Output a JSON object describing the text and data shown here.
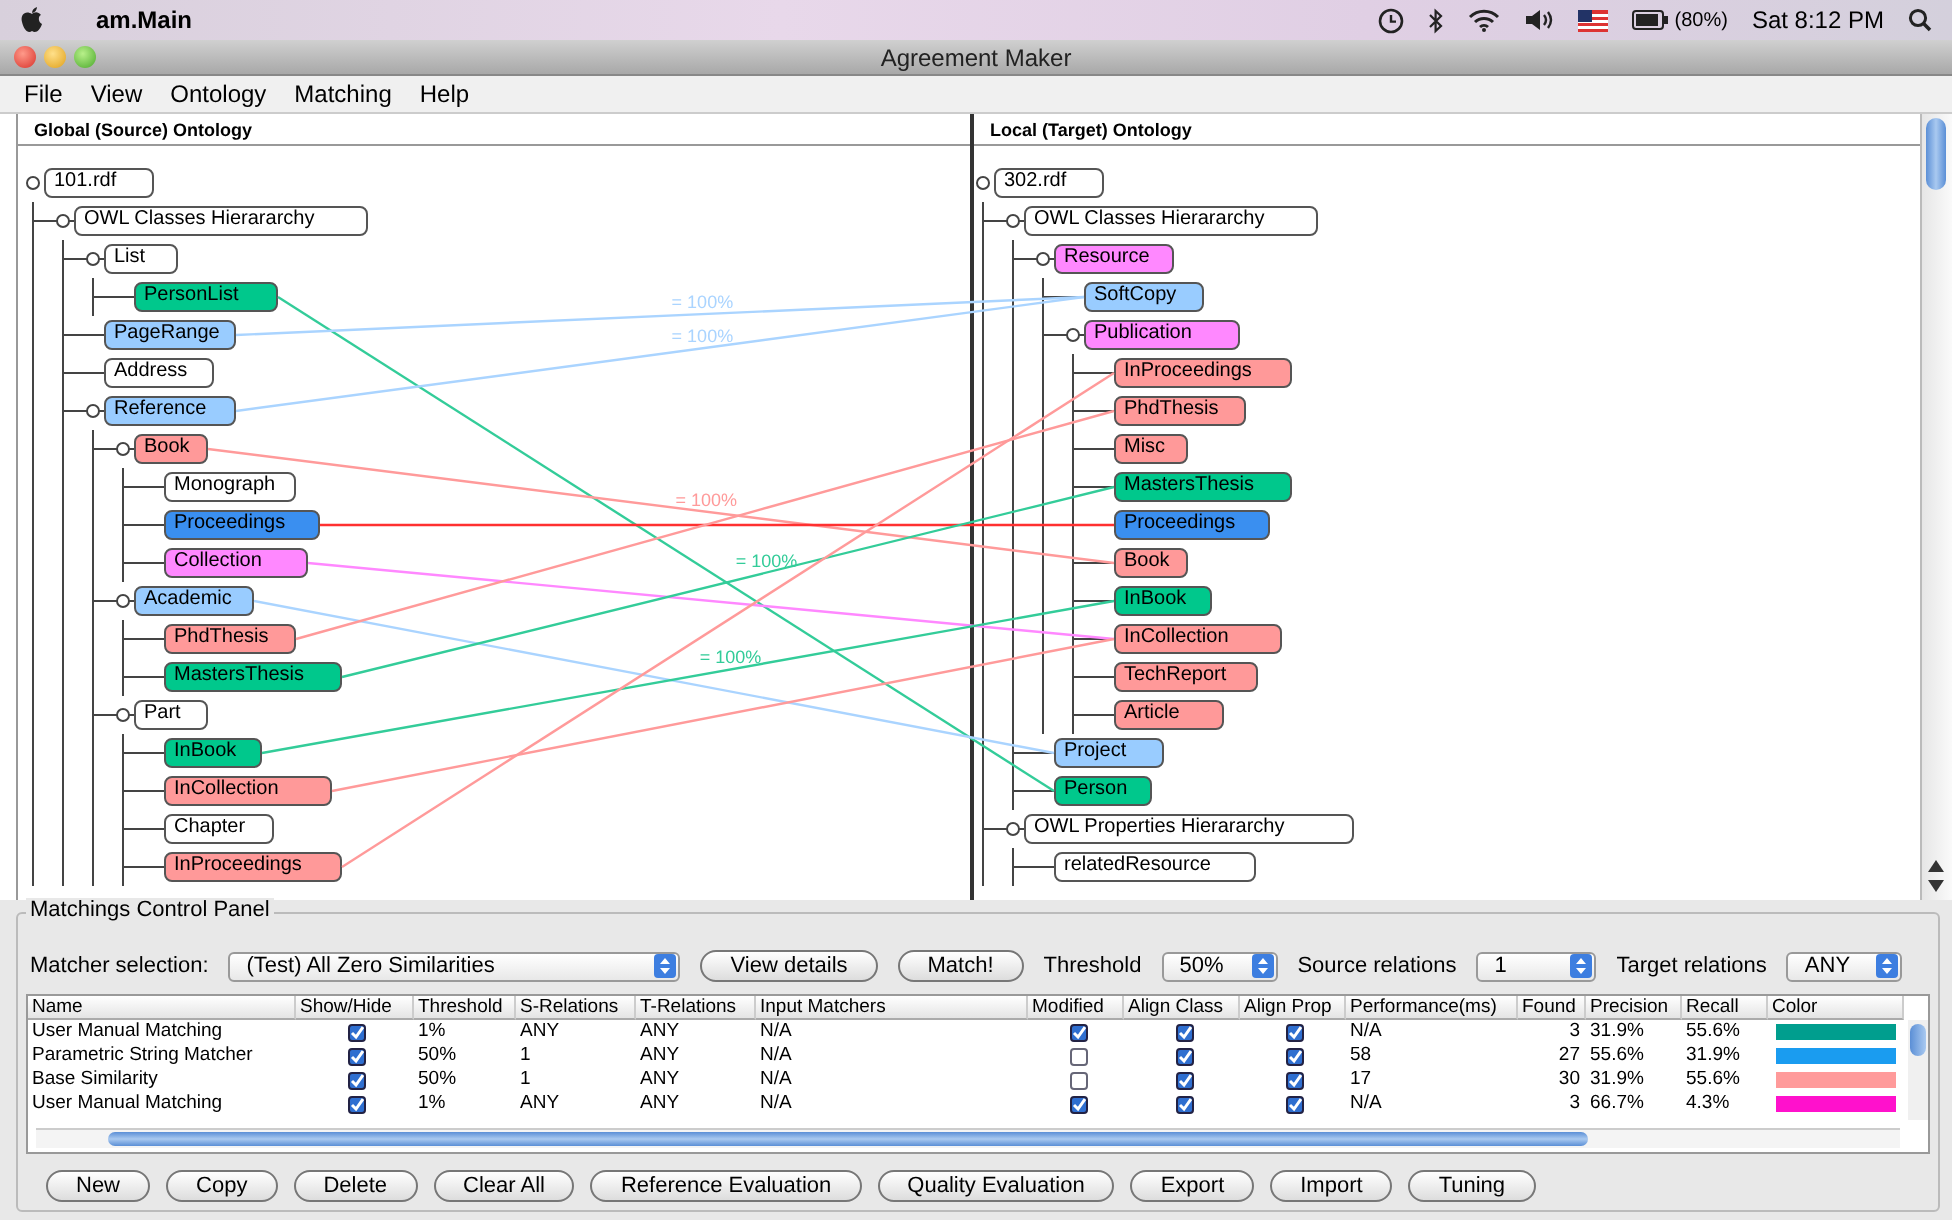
{
  "menubar": {
    "app": "am.Main",
    "battery": "(80%)",
    "clock": "Sat 8:12 PM"
  },
  "window": {
    "title": "Agreement Maker"
  },
  "menu": [
    "File",
    "View",
    "Ontology",
    "Matching",
    "Help"
  ],
  "source_panel": {
    "title": "Global (Source) Ontology",
    "tree": [
      {
        "label": "101.rdf",
        "color": "#ffffff",
        "children": [
          {
            "label": "OWL Classes Hierararchy",
            "color": "#ffffff",
            "children": [
              {
                "label": "List",
                "color": "#ffffff",
                "children": [
                  {
                    "label": "PersonList",
                    "color": "#00c88c"
                  }
                ]
              },
              {
                "label": "PageRange",
                "color": "#99ccff"
              },
              {
                "label": "Address",
                "color": "#ffffff"
              },
              {
                "label": "Reference",
                "color": "#99ccff",
                "children": [
                  {
                    "label": "Book",
                    "color": "#ff9999",
                    "children": [
                      {
                        "label": "Monograph",
                        "color": "#ffffff"
                      },
                      {
                        "label": "Proceedings",
                        "color": "#3a8ff0"
                      },
                      {
                        "label": "Collection",
                        "color": "#ff88ff"
                      }
                    ]
                  },
                  {
                    "label": "Academic",
                    "color": "#99ccff",
                    "children": [
                      {
                        "label": "PhdThesis",
                        "color": "#ff9999"
                      },
                      {
                        "label": "MastersThesis",
                        "color": "#00c88c"
                      }
                    ]
                  },
                  {
                    "label": "Part",
                    "color": "#ffffff",
                    "children": [
                      {
                        "label": "InBook",
                        "color": "#00c88c"
                      },
                      {
                        "label": "InCollection",
                        "color": "#ff9999"
                      },
                      {
                        "label": "Chapter",
                        "color": "#ffffff"
                      },
                      {
                        "label": "InProceedings",
                        "color": "#ff9999"
                      }
                    ]
                  }
                ]
              }
            ]
          }
        ]
      }
    ]
  },
  "target_panel": {
    "title": "Local (Target) Ontology",
    "tree": [
      {
        "label": "302.rdf",
        "color": "#ffffff",
        "children": [
          {
            "label": "OWL Classes Hierararchy",
            "color": "#ffffff",
            "children": [
              {
                "label": "Resource",
                "color": "#ff88ff",
                "children": [
                  {
                    "label": "SoftCopy",
                    "color": "#99ccff"
                  },
                  {
                    "label": "Publication",
                    "color": "#ff88ff",
                    "children": [
                      {
                        "label": "InProceedings",
                        "color": "#ff9999"
                      },
                      {
                        "label": "PhdThesis",
                        "color": "#ff9999"
                      },
                      {
                        "label": "Misc",
                        "color": "#ff9999"
                      },
                      {
                        "label": "MastersThesis",
                        "color": "#00c88c"
                      },
                      {
                        "label": "Proceedings",
                        "color": "#3a8ff0"
                      },
                      {
                        "label": "Book",
                        "color": "#ff9999"
                      },
                      {
                        "label": "InBook",
                        "color": "#00c88c"
                      },
                      {
                        "label": "InCollection",
                        "color": "#ff9999"
                      },
                      {
                        "label": "TechReport",
                        "color": "#ff9999"
                      },
                      {
                        "label": "Article",
                        "color": "#ff9999"
                      }
                    ]
                  }
                ]
              },
              {
                "label": "Project",
                "color": "#99ccff"
              },
              {
                "label": "Person",
                "color": "#00c88c"
              }
            ]
          },
          {
            "label": "OWL Properties Hierararchy",
            "color": "#ffffff",
            "children": [
              {
                "label": "relatedResource",
                "color": "#ffffff"
              }
            ]
          }
        ]
      }
    ]
  },
  "similarity_labels": [
    "= 100%",
    "= 100%",
    "= 100%",
    "= 100%",
    "= 100%"
  ],
  "control_panel": {
    "title": "Matchings Control Panel",
    "controls": [
      {
        "kind": "label",
        "text": "Matcher selection:"
      },
      {
        "kind": "select",
        "value": "(Test) All Zero Similarities"
      },
      {
        "kind": "button",
        "text": "View details"
      },
      {
        "kind": "button",
        "text": "Match!"
      },
      {
        "kind": "label",
        "text": "Threshold"
      },
      {
        "kind": "select",
        "value": "50%"
      },
      {
        "kind": "label",
        "text": "Source relations"
      },
      {
        "kind": "select",
        "value": "1"
      },
      {
        "kind": "label",
        "text": "Target relations"
      },
      {
        "kind": "select",
        "value": "ANY"
      }
    ]
  },
  "table": {
    "columns": [
      {
        "label": "Name",
        "kind": "text"
      },
      {
        "label": "Show/Hide",
        "kind": "check"
      },
      {
        "label": "Threshold",
        "kind": "text"
      },
      {
        "label": "S-Relations",
        "kind": "text"
      },
      {
        "label": "T-Relations",
        "kind": "text"
      },
      {
        "label": "Input Matchers",
        "kind": "text"
      },
      {
        "label": "Modified",
        "kind": "check"
      },
      {
        "label": "Align Class",
        "kind": "check"
      },
      {
        "label": "Align Prop",
        "kind": "check"
      },
      {
        "label": "Performance(ms)",
        "kind": "text"
      },
      {
        "label": "Found",
        "kind": "number"
      },
      {
        "label": "Precision",
        "kind": "text"
      },
      {
        "label": "Recall",
        "kind": "text"
      },
      {
        "label": "Color",
        "kind": "color"
      }
    ],
    "rows": [
      {
        "cells": [
          "User Manual Matching",
          true,
          "1%",
          "ANY",
          "ANY",
          "N/A",
          true,
          true,
          true,
          "N/A",
          "3",
          "31.9%",
          "55.6%"
        ],
        "color": "#009e8e"
      },
      {
        "cells": [
          "Parametric String Matcher",
          true,
          "50%",
          "1",
          "ANY",
          "N/A",
          false,
          true,
          true,
          "58",
          "27",
          "55.6%",
          "31.9%"
        ],
        "color": "#1a9cf0"
      },
      {
        "cells": [
          "Base Similarity",
          true,
          "50%",
          "1",
          "ANY",
          "N/A",
          false,
          true,
          true,
          "17",
          "30",
          "31.9%",
          "55.6%"
        ],
        "color": "#ff9a9a"
      },
      {
        "cells": [
          "User Manual Matching",
          true,
          "1%",
          "ANY",
          "ANY",
          "N/A",
          true,
          true,
          true,
          "N/A",
          "3",
          "66.7%",
          "4.3%"
        ],
        "color": "#ff11cc"
      }
    ]
  },
  "buttons": [
    "New",
    "Copy",
    "Delete",
    "Clear All",
    "Reference Evaluation",
    "Quality Evaluation",
    "Export",
    "Import",
    "Tuning"
  ]
}
